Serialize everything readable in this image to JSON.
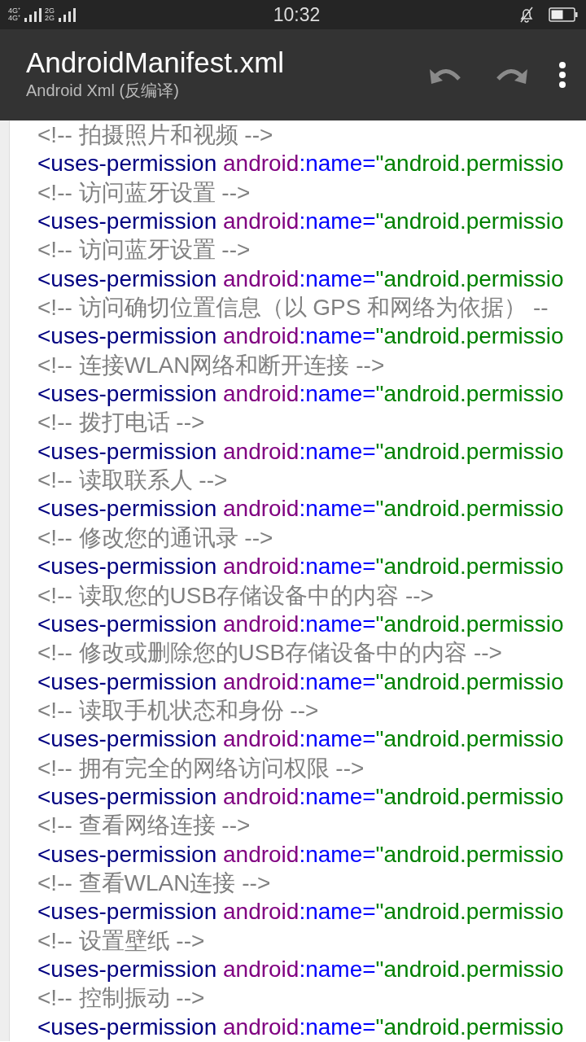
{
  "status_bar": {
    "network_labels": [
      "4G⁺",
      "4G⁺",
      "2G",
      "2G"
    ],
    "time": "10:32"
  },
  "toolbar": {
    "title": "AndroidManifest.xml",
    "subtitle": "Android Xml (反编译)",
    "undo_enabled": false,
    "redo_enabled": false
  },
  "lines": [
    {
      "kind": "comment",
      "text": "<!-- 拍摄照片和视频 -->"
    },
    {
      "kind": "tag",
      "tag": "<uses-permission",
      "attr_prefix": "android",
      "attr_name": ":name=",
      "value": "\"android.permissio"
    },
    {
      "kind": "comment",
      "text": "<!-- 访问蓝牙设置 -->"
    },
    {
      "kind": "tag",
      "tag": "<uses-permission",
      "attr_prefix": "android",
      "attr_name": ":name=",
      "value": "\"android.permissio"
    },
    {
      "kind": "comment",
      "text": "<!-- 访问蓝牙设置 -->"
    },
    {
      "kind": "tag",
      "tag": "<uses-permission",
      "attr_prefix": "android",
      "attr_name": ":name=",
      "value": "\"android.permissio"
    },
    {
      "kind": "comment",
      "text": "<!-- 访问确切位置信息（以 GPS 和网络为依据） --"
    },
    {
      "kind": "tag",
      "tag": "<uses-permission",
      "attr_prefix": "android",
      "attr_name": ":name=",
      "value": "\"android.permissio"
    },
    {
      "kind": "comment",
      "text": "<!-- 连接WLAN网络和断开连接 -->"
    },
    {
      "kind": "tag",
      "tag": "<uses-permission",
      "attr_prefix": "android",
      "attr_name": ":name=",
      "value": "\"android.permissio"
    },
    {
      "kind": "comment",
      "text": "<!-- 拨打电话 -->"
    },
    {
      "kind": "tag",
      "tag": "<uses-permission",
      "attr_prefix": "android",
      "attr_name": ":name=",
      "value": "\"android.permissio"
    },
    {
      "kind": "comment",
      "text": "<!-- 读取联系人 -->"
    },
    {
      "kind": "tag",
      "tag": "<uses-permission",
      "attr_prefix": "android",
      "attr_name": ":name=",
      "value": "\"android.permissio"
    },
    {
      "kind": "comment",
      "text": "<!-- 修改您的通讯录 -->"
    },
    {
      "kind": "tag",
      "tag": "<uses-permission",
      "attr_prefix": "android",
      "attr_name": ":name=",
      "value": "\"android.permissio"
    },
    {
      "kind": "comment",
      "text": "<!-- 读取您的USB存储设备中的内容 -->"
    },
    {
      "kind": "tag",
      "tag": "<uses-permission",
      "attr_prefix": "android",
      "attr_name": ":name=",
      "value": "\"android.permissio"
    },
    {
      "kind": "comment",
      "text": "<!-- 修改或删除您的USB存储设备中的内容 -->"
    },
    {
      "kind": "tag",
      "tag": "<uses-permission",
      "attr_prefix": "android",
      "attr_name": ":name=",
      "value": "\"android.permissio"
    },
    {
      "kind": "comment",
      "text": "<!-- 读取手机状态和身份 -->"
    },
    {
      "kind": "tag",
      "tag": "<uses-permission",
      "attr_prefix": "android",
      "attr_name": ":name=",
      "value": "\"android.permissio"
    },
    {
      "kind": "comment",
      "text": "<!-- 拥有完全的网络访问权限 -->"
    },
    {
      "kind": "tag",
      "tag": "<uses-permission",
      "attr_prefix": "android",
      "attr_name": ":name=",
      "value": "\"android.permissio"
    },
    {
      "kind": "comment",
      "text": "<!-- 查看网络连接 -->"
    },
    {
      "kind": "tag",
      "tag": "<uses-permission",
      "attr_prefix": "android",
      "attr_name": ":name=",
      "value": "\"android.permissio"
    },
    {
      "kind": "comment",
      "text": "<!-- 查看WLAN连接 -->"
    },
    {
      "kind": "tag",
      "tag": "<uses-permission",
      "attr_prefix": "android",
      "attr_name": ":name=",
      "value": "\"android.permissio"
    },
    {
      "kind": "comment",
      "text": "<!-- 设置壁纸 -->"
    },
    {
      "kind": "tag",
      "tag": "<uses-permission",
      "attr_prefix": "android",
      "attr_name": ":name=",
      "value": "\"android.permissio"
    },
    {
      "kind": "comment",
      "text": "<!-- 控制振动 -->"
    },
    {
      "kind": "tag",
      "tag": "<uses-permission",
      "attr_prefix": "android",
      "attr_name": ":name=",
      "value": "\"android.permissio"
    }
  ]
}
